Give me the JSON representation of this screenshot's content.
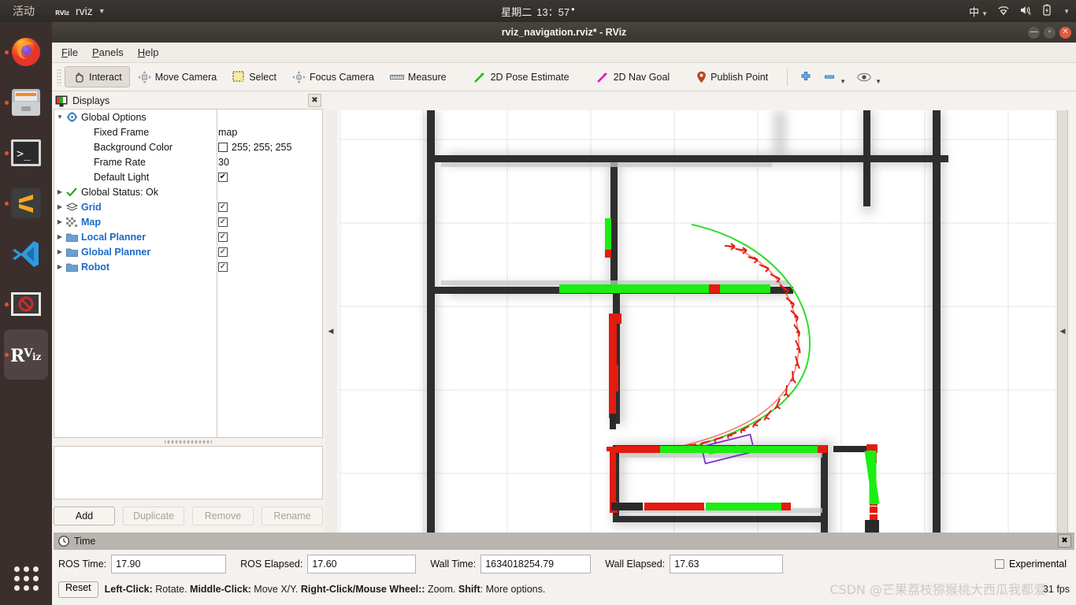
{
  "desktop": {
    "activities": "活动",
    "app_indicator_icon": "rviz-icon",
    "app_name": "rviz",
    "app_caret_icon": "chevron-down-icon",
    "clock_day": "星期二",
    "clock_time": "13：57",
    "clock_dot_icon": "recording-dot-icon",
    "input_method": "中",
    "tray_icons": [
      "wifi-icon",
      "volume-muted-icon",
      "battery-charging-icon",
      "chevron-down-icon"
    ],
    "dock_items": [
      {
        "name": "firefox-icon",
        "label": "Firefox",
        "running": true
      },
      {
        "name": "files-icon",
        "label": "Files",
        "running": true
      },
      {
        "name": "terminal-icon",
        "label": "Terminal",
        "running": true
      },
      {
        "name": "sublime-text-icon",
        "label": "Sublime Text",
        "running": true
      },
      {
        "name": "vscode-icon",
        "label": "Visual Studio Code",
        "running": false
      },
      {
        "name": "blocked-icon",
        "label": "Blocked App",
        "running": true
      },
      {
        "name": "rviz-icon",
        "label": "RViz",
        "running": true,
        "active": true
      }
    ],
    "show_apps_label": "Show Applications"
  },
  "window": {
    "title": "rviz_navigation.rviz* - RViz",
    "minimize_icon": "minimize-icon",
    "maximize_icon": "maximize-icon",
    "close_icon": "close-icon"
  },
  "menubar": [
    {
      "label": "File",
      "mnemonic": "F"
    },
    {
      "label": "Panels",
      "mnemonic": "P"
    },
    {
      "label": "Help",
      "mnemonic": "H"
    }
  ],
  "toolbar": {
    "tools": [
      {
        "label": "Interact",
        "icon": "hand-cursor-icon",
        "checked": true
      },
      {
        "label": "Move Camera",
        "icon": "move-camera-icon",
        "checked": false
      },
      {
        "label": "Select",
        "icon": "selection-box-icon",
        "checked": false
      },
      {
        "label": "Focus Camera",
        "icon": "focus-camera-icon",
        "checked": false
      },
      {
        "label": "Measure",
        "icon": "ruler-icon",
        "checked": false
      },
      {
        "label": "2D Pose Estimate",
        "icon": "green-arrow-icon",
        "checked": false
      },
      {
        "label": "2D Nav Goal",
        "icon": "magenta-arrow-icon",
        "checked": false
      },
      {
        "label": "Publish Point",
        "icon": "map-pin-icon",
        "checked": false
      }
    ],
    "extra": [
      {
        "icon": "plus-icon",
        "label": "Add Tool"
      },
      {
        "icon": "minus-icon",
        "label": "Remove Tool",
        "has_caret": true
      },
      {
        "icon": "eye-icon",
        "label": "Tool Properties",
        "has_caret": true
      }
    ]
  },
  "displays": {
    "panel_title": "Displays",
    "panel_icon": "displays-monitor-icon",
    "close_icon": "close-icon",
    "tree": [
      {
        "indent": 0,
        "arrow": "expanded",
        "icon": "gear-icon",
        "label": "Global Options",
        "bold": false,
        "value_type": "none",
        "value": ""
      },
      {
        "indent": 1,
        "arrow": "none",
        "icon": "none",
        "label": "Fixed Frame",
        "bold": false,
        "value_type": "text",
        "value": "map"
      },
      {
        "indent": 1,
        "arrow": "none",
        "icon": "none",
        "label": "Background Color",
        "bold": false,
        "value_type": "color",
        "value": "255; 255; 255",
        "color": "#ffffff"
      },
      {
        "indent": 1,
        "arrow": "none",
        "icon": "none",
        "label": "Frame Rate",
        "bold": false,
        "value_type": "text",
        "value": "30"
      },
      {
        "indent": 1,
        "arrow": "none",
        "icon": "none",
        "label": "Default Light",
        "bold": false,
        "value_type": "check",
        "value": "✔"
      },
      {
        "indent": 0,
        "arrow": "collapsed",
        "icon": "green-check-icon",
        "label": "Global Status: Ok",
        "bold": false,
        "value_type": "none",
        "value": ""
      },
      {
        "indent": 0,
        "arrow": "collapsed",
        "icon": "grid-icon",
        "label": "Grid",
        "bold": true,
        "value_type": "check",
        "value": "✓"
      },
      {
        "indent": 0,
        "arrow": "collapsed",
        "icon": "map-icon",
        "label": "Map",
        "bold": true,
        "value_type": "check",
        "value": "✓"
      },
      {
        "indent": 0,
        "arrow": "collapsed",
        "icon": "folder-icon",
        "label": "Local Planner",
        "bold": true,
        "value_type": "check",
        "value": "✓"
      },
      {
        "indent": 0,
        "arrow": "collapsed",
        "icon": "folder-icon",
        "label": "Global Planner",
        "bold": true,
        "value_type": "check",
        "value": "✓"
      },
      {
        "indent": 0,
        "arrow": "collapsed",
        "icon": "folder-icon",
        "label": "Robot",
        "bold": true,
        "value_type": "check",
        "value": "✓"
      }
    ],
    "buttons": [
      {
        "label": "Add",
        "enabled": true
      },
      {
        "label": "Duplicate",
        "enabled": false
      },
      {
        "label": "Remove",
        "enabled": false
      },
      {
        "label": "Rename",
        "enabled": false
      }
    ]
  },
  "view": {
    "left_collapse_icon": "triangle-left-icon",
    "right_collapse_icon": "triangle-left-icon",
    "background_color": "#ffffff",
    "grid_color": "#e3e3e3",
    "obstacle_color": "#ff0000",
    "path_color": "#00ee00",
    "footprint_color": "#7b2fd4"
  },
  "time_panel": {
    "title": "Time",
    "icon": "clock-icon",
    "close_icon": "close-icon",
    "fields": [
      {
        "label": "ROS Time:",
        "value": "17.90"
      },
      {
        "label": "ROS Elapsed:",
        "value": "17.60"
      },
      {
        "label": "Wall Time:",
        "value": "1634018254.79"
      },
      {
        "label": "Wall Elapsed:",
        "value": "17.63"
      }
    ],
    "experimental_label": "Experimental",
    "experimental_checked": false
  },
  "statusbar": {
    "reset_label": "Reset",
    "hint_parts": [
      {
        "text": "Left-Click:",
        "bold": true
      },
      {
        "text": " Rotate. ",
        "bold": false
      },
      {
        "text": "Middle-Click:",
        "bold": true
      },
      {
        "text": " Move X/Y. ",
        "bold": false
      },
      {
        "text": "Right-Click/Mouse Wheel::",
        "bold": true
      },
      {
        "text": " Zoom. ",
        "bold": false
      },
      {
        "text": "Shift",
        "bold": true
      },
      {
        "text": ": More options.",
        "bold": false
      }
    ],
    "fps": "31 fps",
    "watermark": "CSDN @芒果荔枝猕猴桃大西瓜我都爱"
  }
}
